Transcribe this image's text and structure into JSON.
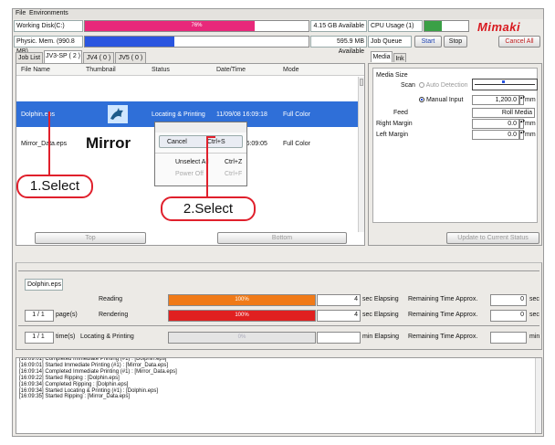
{
  "menu": {
    "file": "File",
    "environments": "Environments"
  },
  "status": {
    "working_disk_label": "Working Disk(C:)",
    "working_disk_pct": "76%",
    "working_disk_fraction": 0.76,
    "working_disk_avail": "4.15 GB Available",
    "cpu_label": "CPU Usage (1)",
    "cpu_pct": "4%",
    "cpu_fraction": 0.4,
    "phys_mem_label": "Physic. Mem. (990.8 MB)",
    "phys_mem_pct": "40%",
    "phys_mem_fraction": 0.4,
    "phys_mem_avail": "595.9 MB Available",
    "job_queue_label": "Job Queue",
    "start_label": "Start",
    "stop_label": "Stop",
    "cancel_all_label": "Cancel All",
    "brand": "MIMAKI"
  },
  "tabs": [
    "Job List",
    "JV3-SP ( 2 )",
    "JV4 ( 0 )",
    "JV5 ( 0 )"
  ],
  "table": {
    "headers": [
      "File Name",
      "Thumbnail",
      "Status",
      "Date/Time",
      "Mode"
    ],
    "rows": [
      {
        "file": "Dolphin.eps",
        "status": "Locating & Printing",
        "datetime": "11/09/08 16:09:18",
        "mode": "Full Color"
      },
      {
        "file": "Mirror_Data.eps",
        "thumb_text": "Mirror",
        "datetime": "11/09/08 16:09:05",
        "mode": "Full Color"
      }
    ],
    "top_label": "Top",
    "bottom_label": "Bottom"
  },
  "context_menu": {
    "items": [
      {
        "label": "Cancel",
        "shortcut": "Ctrl+S"
      },
      {
        "label": "Unselect All",
        "shortcut": "Ctrl+Z"
      },
      {
        "label": "Power Off",
        "shortcut": "Ctrl+F"
      }
    ]
  },
  "callouts": {
    "first": "1.Select",
    "second": "2.Select"
  },
  "media": {
    "tab_media": "Media",
    "tab_ink": "Ink",
    "section": "Media Size",
    "scan_label": "Scan",
    "auto_detection": "Auto Detection",
    "manual_input": "Manual Input",
    "manual_value": "1,200.0",
    "unit_mm": "mm",
    "feed_label": "Feed",
    "feed_value": "Roll Media",
    "right_margin_label": "Right Margin",
    "right_margin_value": "0.0",
    "left_margin_label": "Left Margin",
    "left_margin_value": "0.0",
    "update_btn": "Update to Current Status"
  },
  "progress": {
    "file": "Dolphin.eps",
    "reading_label": "Reading",
    "reading_pct": "100%",
    "reading_fraction": 1.0,
    "reading_sec": "4",
    "rendering_label": "Rendering",
    "rendering_pct": "100%",
    "rendering_fraction": 1.0,
    "rendering_sec": "4",
    "pages": "1 / 1",
    "pages_label": "page(s)",
    "times": "1 / 1",
    "times_label": "time(s)",
    "locating_label": "Locating & Printing",
    "locating_pct": "0%",
    "locating_fraction": 0.0,
    "sec_elapsing": "sec Elapsing",
    "min_elapsing": "min Elapsing",
    "remaining": "Remaining Time Approx.",
    "remaining_sec_1": "0",
    "remaining_sec_2": "0",
    "sec": "sec",
    "min": "min"
  },
  "log": [
    "[16:09:01] Completed Immediate Printing (#1) : [Dolphin.eps]",
    "[16:09:01] Started Immediate Printing (#1) : [Mirror_Data.eps]",
    "[16:09:14] Completed Immediate Printing (#1) : [Mirror_Data.eps]",
    "[16:09:22] Started Ripping : [Dolphin.eps]",
    "[16:09:34] Completed Ripping : [Dolphin.eps]",
    "[16:09:34] Started Locating & Printing (#1) : [Dolphin.eps]",
    "[16:09:35] Started Ripping : [Mirror_Data.eps]"
  ],
  "colors": {
    "pink": "#e8287a",
    "blue": "#2a55e0",
    "green": "#3aa046",
    "orange": "#f07a18",
    "red": "#e02020",
    "select": "#2f6fd8",
    "callout": "#e0202c"
  }
}
